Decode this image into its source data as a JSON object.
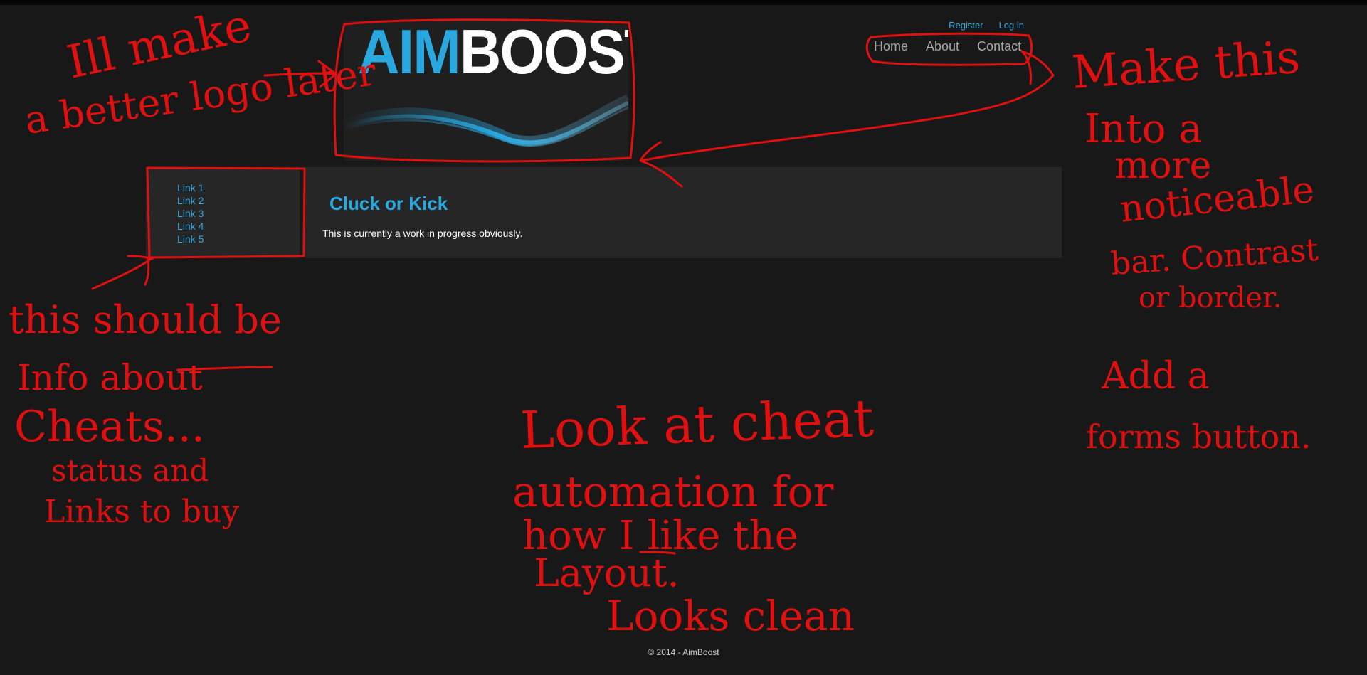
{
  "logo": {
    "part1": "AIM",
    "part2": "BOOST"
  },
  "account": {
    "register": "Register",
    "login": "Log in"
  },
  "nav": {
    "home": "Home",
    "about": "About",
    "contact": "Contact"
  },
  "sidebar": {
    "links": [
      "Link 1",
      "Link 2",
      "Link 3",
      "Link 4",
      "Link 5"
    ]
  },
  "content": {
    "title": "Cluck or Kick",
    "text": "This is currently a work in progress obviously."
  },
  "footer": {
    "text": "© 2014 - AimBoost"
  },
  "annotations": {
    "logo_note_1": "Ill make",
    "logo_note_2": "a better logo later",
    "nav_note_1": "Make this",
    "nav_note_2": "Into a",
    "nav_note_3": "more",
    "nav_note_4": "noticeable",
    "nav_note_5": "bar. Contrast",
    "nav_note_6": "or border.",
    "forms_note_1": "Add a",
    "forms_note_2": "forms button.",
    "sidebar_note_1": "this should be",
    "sidebar_note_2": "Info about",
    "sidebar_note_3": "Cheats...",
    "sidebar_note_4": "status and",
    "sidebar_note_5": "Links to buy",
    "layout_note_1": "Look at cheat",
    "layout_note_2": "automation for",
    "layout_note_3": "how I like the",
    "layout_note_4": "Layout.",
    "layout_note_5": "Looks clean"
  },
  "colors": {
    "background": "#181818",
    "panel": "#262626",
    "accent": "#29a8e0",
    "annotation": "#e01010"
  }
}
